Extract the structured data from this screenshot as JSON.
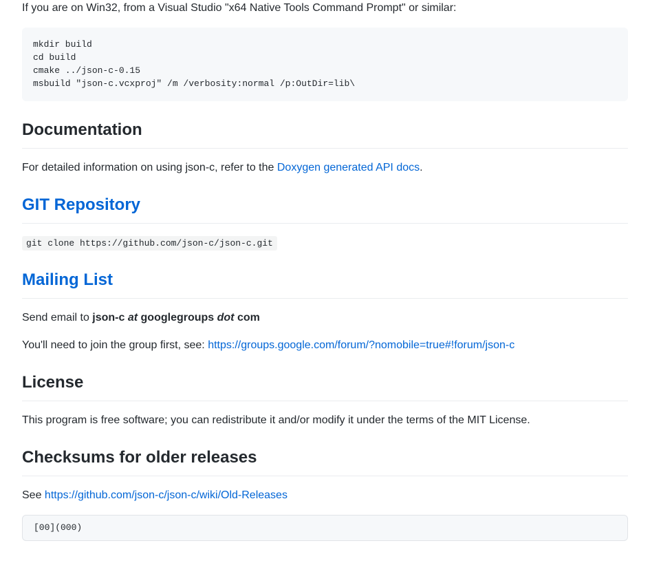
{
  "intro": "If you are on Win32, from a Visual Studio \"x64 Native Tools Command Prompt\" or similar:",
  "codeblock1": "mkdir build\ncd build\ncmake ../json-c-0.15\nmsbuild \"json-c.vcxproj\" /m /verbosity:normal /p:OutDir=lib\\",
  "documentation": {
    "heading": "Documentation",
    "text_prefix": "For detailed information on using json-c, refer to the ",
    "link": "Doxygen generated API docs",
    "text_suffix": "."
  },
  "git": {
    "heading": "GIT Repository",
    "code": "git clone https://github.com/json-c/json-c.git"
  },
  "mailinglist": {
    "heading": "Mailing List",
    "text_prefix": "Send email to ",
    "bold1": "json-c ",
    "italic1": "at",
    "bold2": " googlegroups ",
    "italic2": "dot",
    "bold3": " com",
    "join_prefix": "You'll need to join the group first, see: ",
    "join_link": "https://groups.google.com/forum/?nomobile=true#!forum/json-c"
  },
  "license": {
    "heading": "License",
    "text": "This program is free software; you can redistribute it and/or modify it under the terms of the MIT License."
  },
  "checksums": {
    "heading": "Checksums for older releases",
    "text_prefix": "See ",
    "link": "https://github.com/json-c/json-c/wiki/Old-Releases"
  },
  "bottom": "[00](000)"
}
